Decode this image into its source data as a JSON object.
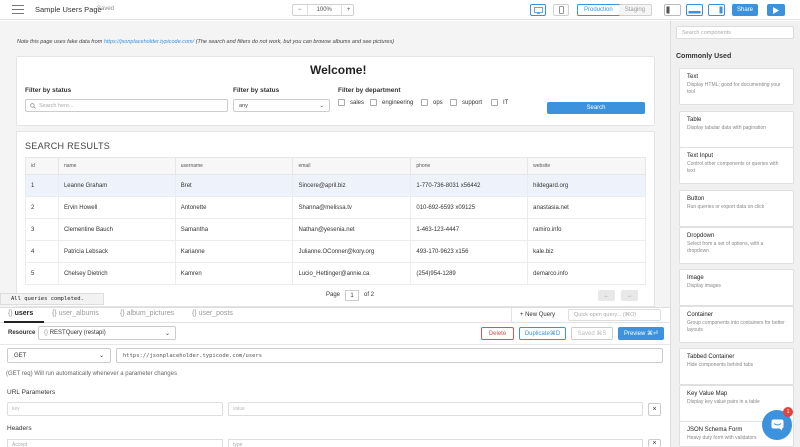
{
  "app": {
    "title": "Sample Users Page",
    "status": "Saved"
  },
  "toolbar": {
    "zoom_minus": "−",
    "zoom_value": "100%",
    "zoom_plus": "+",
    "env_production": "Production",
    "env_staging": "Staging",
    "share_label": "Share"
  },
  "note": {
    "prefix": "Note this page uses fake data from ",
    "link": "https://jsonplaceholder.typicode.com/",
    "suffix": " (The search and filters do not work, but you can browse albums and see pictures)"
  },
  "filters": {
    "welcome": "Welcome!",
    "by_status_label_1": "Filter by status",
    "search_placeholder": "Search here...",
    "by_status_label_2": "Filter by status",
    "status_value": "any",
    "by_department_label": "Filter by department",
    "departments": [
      "sales",
      "engineering",
      "ops",
      "support",
      "IT"
    ],
    "search_button": "Search"
  },
  "results": {
    "title": "SEARCH RESULTS",
    "columns": [
      "id",
      "name",
      "username",
      "email",
      "phone",
      "website"
    ],
    "rows": [
      [
        "1",
        "Leanne Graham",
        "Bret",
        "Sincere@april.biz",
        "1-770-736-8031 x56442",
        "hildegard.org"
      ],
      [
        "2",
        "Ervin Howell",
        "Antonette",
        "Shanna@melissa.tv",
        "010-692-6593 x09125",
        "anastasia.net"
      ],
      [
        "3",
        "Clementine Bauch",
        "Samantha",
        "Nathan@yesenia.net",
        "1-463-123-4447",
        "ramiro.info"
      ],
      [
        "4",
        "Patricia Lebsack",
        "Karianne",
        "Julianne.OConner@kory.org",
        "493-170-9623 x156",
        "kale.biz"
      ],
      [
        "5",
        "Chelsey Dietrich",
        "Kamren",
        "Lucio_Hettinger@annie.ca",
        "(254)954-1289",
        "demarco.info"
      ]
    ],
    "page_label": "Page",
    "page_value": "1",
    "page_of": "of 2",
    "prev": "←",
    "next": "→"
  },
  "toast": "All queries completed.",
  "queries": {
    "tabs": [
      "users",
      "user_albums",
      "album_pictures",
      "user_posts"
    ],
    "new_query": "+ New Query",
    "quick_open": "Quick open query... (⌘O)",
    "resource_label": "Resource",
    "resource_value": "RESTQuery (restapi)",
    "delete": "Delete",
    "duplicate": "Duplicate⌘D",
    "save": "Saved ⌘S",
    "preview": "Preview ⌘⏎",
    "method": "GET",
    "url": "https://jsonplaceholder.typicode.com/users",
    "hint": "(GET req) Will run automatically whenever a parameter changes",
    "url_params_label": "URL Parameters",
    "key_placeholder": "key",
    "value_placeholder": "value",
    "headers_label": "Headers",
    "header_key": "Accept",
    "header_value": "type"
  },
  "sidebar": {
    "search_placeholder": "Search components",
    "heading": "Commonly Used",
    "components": [
      {
        "title": "Text",
        "desc": "Display HTML; good for documenting your tool"
      },
      {
        "title": "Table",
        "desc": "Display tabular data with pagination"
      },
      {
        "title": "Text Input",
        "desc": "Control other components or queries with text"
      },
      {
        "title": "Button",
        "desc": "Run queries or export data on click"
      },
      {
        "title": "Dropdown",
        "desc": "Select from a set of options, with a dropdown"
      },
      {
        "title": "Image",
        "desc": "Display images"
      },
      {
        "title": "Container",
        "desc": "Group components into containers for better layouts"
      },
      {
        "title": "Tabbed Container",
        "desc": "Hide components behind tabs"
      },
      {
        "title": "Key Value Map",
        "desc": "Display key value pairs in a table"
      },
      {
        "title": "JSON Schema Form",
        "desc": "Heavy duty form with validators"
      }
    ],
    "chat_badge": "1"
  }
}
